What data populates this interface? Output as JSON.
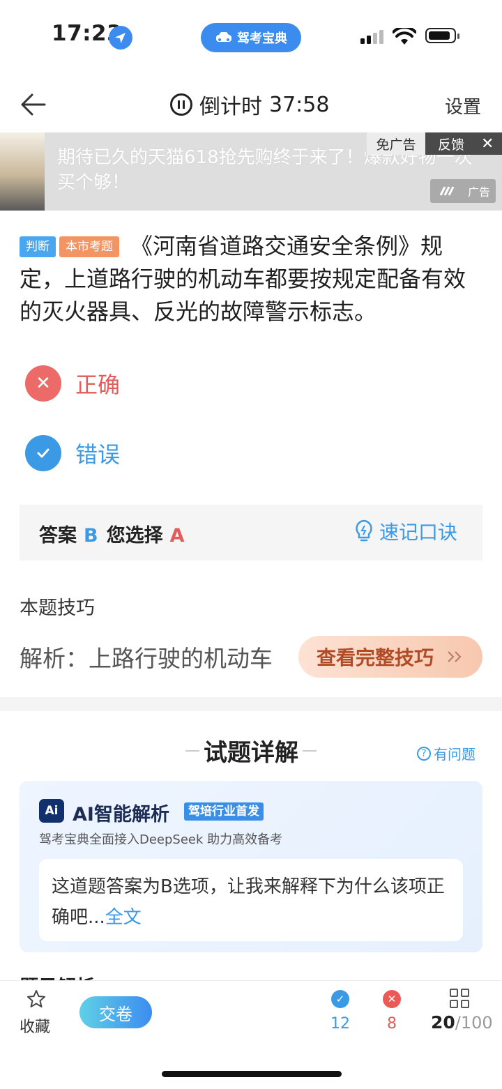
{
  "status_bar": {
    "time": "17:23",
    "app_badge": "驾考宝典"
  },
  "header": {
    "timer_label": "倒计时",
    "timer_value": "37:58",
    "settings": "设置"
  },
  "ad": {
    "text": "期待已久的天猫618抢先购终于来了！爆款好物一次买个够！",
    "no_ads": "免广告",
    "feedback": "反馈",
    "label": "广告"
  },
  "question": {
    "tags": [
      "判断",
      "本市考题"
    ],
    "text": "《河南省道路交通安全条例》规定，上道路行驶的机动车都要按规定配备有效的灭火器具、反光的故障警示标志。",
    "options": [
      {
        "label": "正确",
        "state": "wrong"
      },
      {
        "label": "错误",
        "state": "correct"
      }
    ]
  },
  "answer": {
    "answer_label": "答案",
    "answer_value": "B",
    "chosen_label": "您选择",
    "chosen_value": "A",
    "memo_label": "速记口诀"
  },
  "tips": {
    "title": "本题技巧",
    "text": "解析：上路行驶的机动车",
    "button": "查看完整技巧"
  },
  "detail": {
    "title": "试题详解",
    "report": "有问题",
    "ai": {
      "logo": "Ai",
      "title": "AI智能解析",
      "badge": "驾培行业首发",
      "subtitle": "驾考宝典全面接入DeepSeek 助力高效备考",
      "text": "这道题答案为B选项，让我来解释下为什么该项正确吧...",
      "more": "全文"
    },
    "next_section": "题目解析"
  },
  "toolbar": {
    "favorite": "收藏",
    "submit": "交卷",
    "correct_count": "12",
    "wrong_count": "8",
    "current": "20",
    "total": "/100"
  },
  "colors": {
    "accent": "#3a9ae6",
    "wrong": "#ec6b69",
    "tip_text": "#b04b26"
  }
}
